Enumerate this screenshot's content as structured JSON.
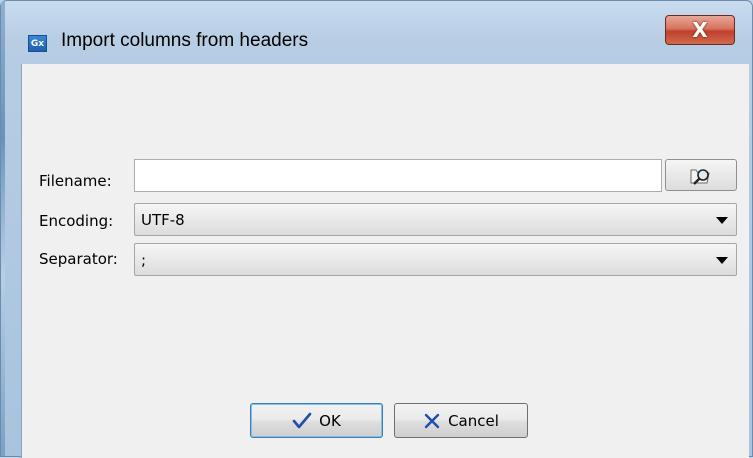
{
  "window": {
    "icon_text": "Gx",
    "title": "Import columns from headers",
    "close_label": "X"
  },
  "form": {
    "filename": {
      "label": "Filename:",
      "value": ""
    },
    "encoding": {
      "label": "Encoding:",
      "value": "UTF-8"
    },
    "separator": {
      "label": "Separator:",
      "value": ";"
    }
  },
  "buttons": {
    "ok_label": "OK",
    "cancel_label": "Cancel"
  },
  "icons": {
    "browse": "browse-folder-search-icon",
    "ok": "checkmark-icon",
    "cancel": "x-cancel-icon",
    "combo": "chevron-down-icon"
  },
  "colors": {
    "ok_check": "#1f4fa8",
    "cancel_x": "#1f4fa8",
    "close_button": "#c0402a"
  }
}
